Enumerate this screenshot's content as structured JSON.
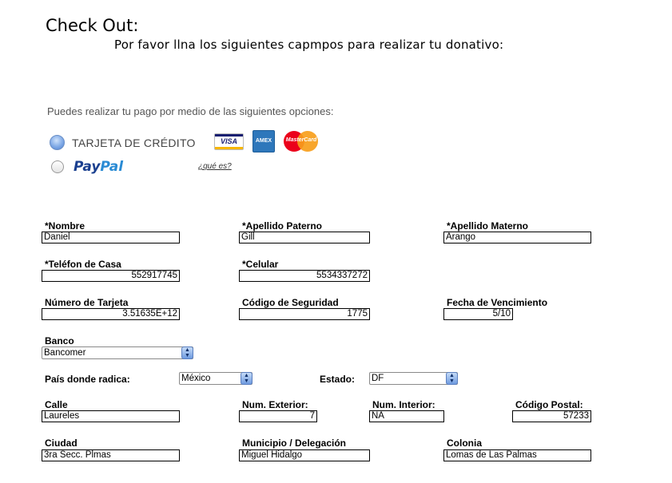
{
  "header": {
    "title": "Check Out:",
    "subtitle": "Por favor llna los siguientes capmpos para realizar tu donativo:"
  },
  "payment": {
    "intro": "Puedes realizar tu pago por medio de las siguientes opciones:",
    "credit_card_label": "TARJETA DE CRÉDITO",
    "credit_card_selected": true,
    "paypal_part1": "Pay",
    "paypal_part2": "Pal",
    "paypal_selected": false,
    "cards": {
      "visa": "VISA",
      "amex": "AMEX",
      "mastercard": "MasterCard"
    },
    "whats_this_link": "¿qué es?"
  },
  "form": {
    "nombre": {
      "label": "*Nombre",
      "value": "Daniel"
    },
    "apellido_paterno": {
      "label": "*Apellido Paterno",
      "value": "Gill"
    },
    "apellido_materno": {
      "label": "*Apellido Materno",
      "value": "Arango"
    },
    "telefono_casa": {
      "label": "*Teléfon de Casa",
      "value": "552917745"
    },
    "celular": {
      "label": "*Celular",
      "value": "5534337272"
    },
    "numero_tarjeta": {
      "label": "Número de Tarjeta",
      "value": "3.51635E+12"
    },
    "codigo_seguridad": {
      "label": "Código de Seguridad",
      "value": "1775"
    },
    "fecha_vencimiento": {
      "label": "Fecha de Vencimiento",
      "value": "5/10"
    },
    "banco": {
      "label": "Banco",
      "value": "Bancomer"
    },
    "pais": {
      "label": "País donde radica:",
      "value": "México"
    },
    "estado": {
      "label": "Estado:",
      "value": "DF"
    },
    "calle": {
      "label": "Calle",
      "value": "Laureles"
    },
    "num_exterior": {
      "label": "Num. Exterior:",
      "value": "7"
    },
    "num_interior": {
      "label": "Num. Interior:",
      "value": "NA"
    },
    "codigo_postal": {
      "label": "Código Postal:",
      "value": "57233"
    },
    "ciudad": {
      "label": "Ciudad",
      "value": "3ra Secc. Plmas"
    },
    "municipio": {
      "label": "Municipio / Delegación",
      "value": "Miguel Hidalgo"
    },
    "colonia": {
      "label": "Colonia",
      "value": "Lomas de Las Palmas"
    }
  },
  "colors": {
    "visa_blue": "#1a1f71",
    "amex_blue": "#2e77bb",
    "mastercard_red": "#eb001b",
    "mastercard_orange": "#f79e1b"
  }
}
